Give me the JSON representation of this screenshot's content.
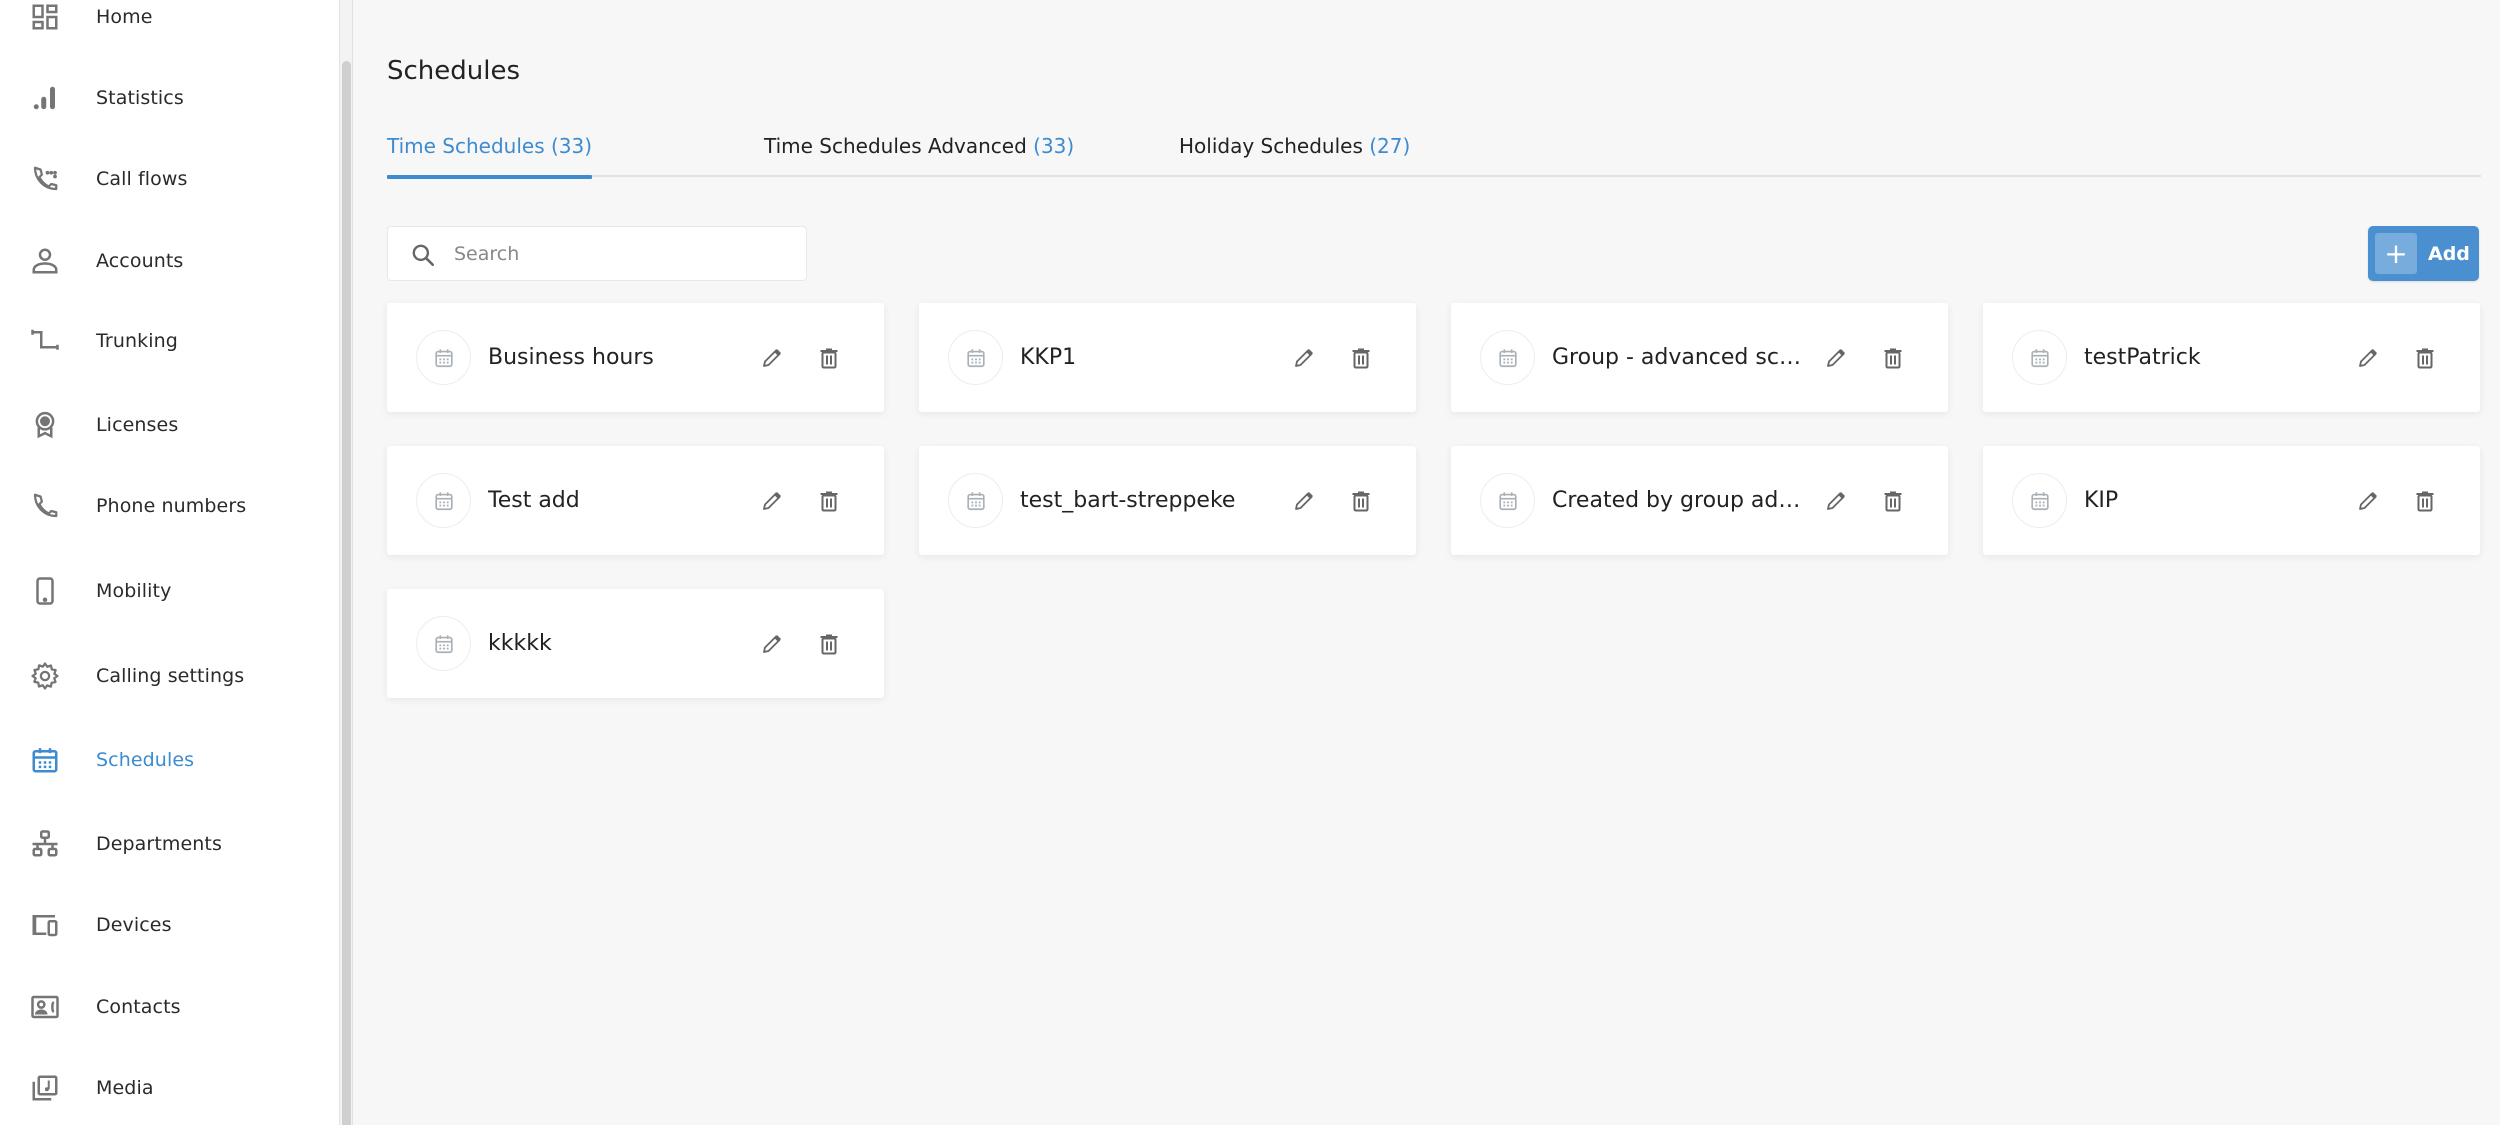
{
  "sidebar": {
    "items": [
      {
        "label": "Home",
        "icon": "dashboard-icon",
        "active": false
      },
      {
        "label": "Statistics",
        "icon": "bar-chart-icon",
        "active": false
      },
      {
        "label": "Call flows",
        "icon": "call-flow-icon",
        "active": false
      },
      {
        "label": "Accounts",
        "icon": "person-icon",
        "active": false
      },
      {
        "label": "Trunking",
        "icon": "trunk-icon",
        "active": false
      },
      {
        "label": "Licenses",
        "icon": "license-badge-icon",
        "active": false
      },
      {
        "label": "Phone numbers",
        "icon": "phone-icon",
        "active": false
      },
      {
        "label": "Mobility",
        "icon": "mobile-phone-icon",
        "active": false
      },
      {
        "label": "Calling settings",
        "icon": "gear-icon",
        "active": false
      },
      {
        "label": "Schedules",
        "icon": "calendar-icon",
        "active": true
      },
      {
        "label": "Departments",
        "icon": "org-tree-icon",
        "active": false
      },
      {
        "label": "Devices",
        "icon": "devices-icon",
        "active": false
      },
      {
        "label": "Contacts",
        "icon": "contact-card-icon",
        "active": false
      },
      {
        "label": "Media",
        "icon": "media-library-icon",
        "active": false
      }
    ]
  },
  "page": {
    "title": "Schedules"
  },
  "tabs": [
    {
      "label": "Time Schedules",
      "count": "(33)",
      "active": true
    },
    {
      "label": "Time Schedules Advanced",
      "count": "(33)",
      "active": false
    },
    {
      "label": "Holiday Schedules",
      "count": "(27)",
      "active": false
    }
  ],
  "search": {
    "placeholder": "Search",
    "value": ""
  },
  "toolbar": {
    "add_label": "Add",
    "add_icon": "plus-icon"
  },
  "schedules": [
    {
      "name": "Business hours"
    },
    {
      "name": "KKP1"
    },
    {
      "name": "Group - advanced schedule"
    },
    {
      "name": "testPatrick"
    },
    {
      "name": "Test add"
    },
    {
      "name": "test_bart-streppeke"
    },
    {
      "name": "Created by group admin"
    },
    {
      "name": "KIP"
    },
    {
      "name": "kkkkk"
    }
  ],
  "colors": {
    "accent": "#3d8bd0",
    "add_button": "#4a90d0",
    "background": "#f7f7f7",
    "icon_gray": "#757575"
  }
}
